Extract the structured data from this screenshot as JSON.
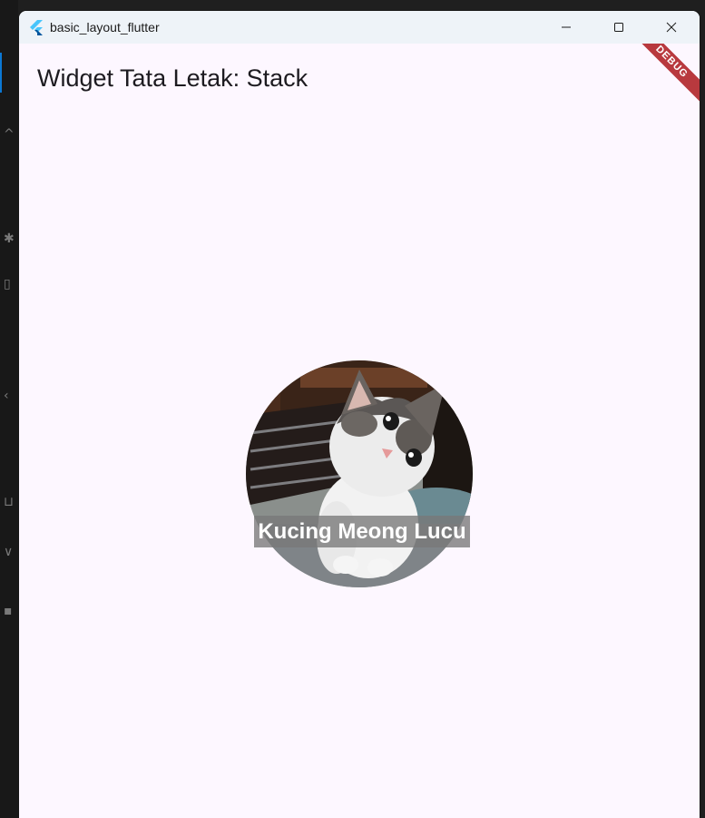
{
  "window": {
    "title": "basic_layout_flutter",
    "controls": [
      "minimize-icon",
      "maximize-icon",
      "close-icon"
    ]
  },
  "app": {
    "page_title": "Widget Tata Letak: Stack",
    "debug_label": "DEBUG",
    "image_caption": "Kucing Meong Lucu",
    "image_subject": "kitten photo"
  },
  "colors": {
    "background": "#fdf7ff",
    "titlebar": "#eef3f8",
    "debug_banner": "#b8393e",
    "caption_background": "#787878",
    "caption_text": "#ffffff"
  }
}
